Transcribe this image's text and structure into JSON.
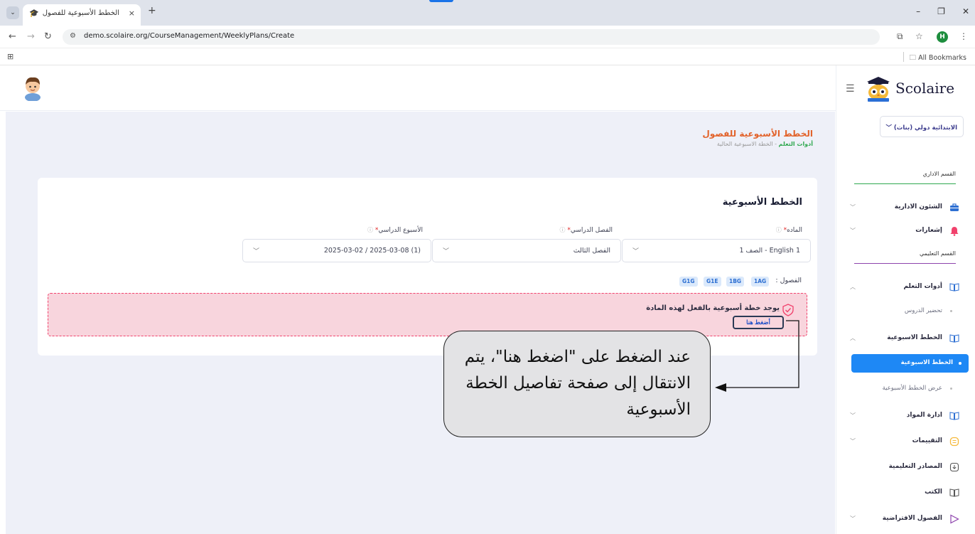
{
  "browser": {
    "tab_title": "الخطط الأسبوعية للفصول",
    "tab_close": "×",
    "new_tab": "+",
    "url": "demo.scolaire.org/CourseManagement/WeeklyPlans/Create",
    "all_bookmarks": "All Bookmarks",
    "profile_initial": "H"
  },
  "header": {
    "page_title": "الخطط الأسبوعية للفصول",
    "breadcrumb_link": "أدوات التعلم",
    "breadcrumb_sep": "-",
    "breadcrumb_current": "الخطة الاسبوعية الحالية"
  },
  "card": {
    "title": "الخطط الأسبوعية",
    "subject_label": "الماده",
    "term_label": "الفصل الدراسي",
    "week_label": "الأسبوع الدراسي",
    "required_mark": "*",
    "info_mark": "ⓘ",
    "subject_value": "1 English - الصف 1",
    "term_value": "الفصل الثالث",
    "week_value": "(1) 2025-03-08 / 2025-03-02",
    "classes_label": "الفصول :",
    "classes": [
      "1AG",
      "1BG",
      "G1E",
      "G1G"
    ]
  },
  "alert": {
    "text": "يوجد خطة أسبوعية بالفعل لهذه المادة",
    "link": "أضغط هنا"
  },
  "callout": {
    "text": "عند الضغط على \"اضغط هنا\"، يتم الانتقال إلى صفحة تفاصيل الخطة الأسبوعية"
  },
  "sidebar": {
    "logo_text": "Scolaire",
    "school": "الابتدائية دولي (بنات)",
    "section_admin": "القسم الاداري",
    "section_edu": "القسم التعليمي",
    "items": {
      "admin_affairs": "الشئون الادارية",
      "notifications": "إشعارات",
      "learning_tools": "أدوات التعلم",
      "lesson_prep": "تحضير الدروس",
      "weekly_plans": "الخطط الاسبوعية",
      "weekly_plans_active": "الخطط الاسبوعية",
      "view_weekly_plans": "عرض الخطط الأسبوعية",
      "subjects_mgmt": "ادارة المواد",
      "assessments": "التقييمات",
      "resources": "المصادر التعليمية",
      "books": "الكتب",
      "virtual_classes": "الفصول الافتراضية"
    }
  },
  "colors": {
    "accent": "#1e88f5",
    "title": "#e2632b",
    "breadcrumb_link": "#2fa84f",
    "alert_bg": "#f8d5dd",
    "alert_border": "#f1416c",
    "admin_rule": "#2fa84f",
    "edu_rule": "#8e44ad"
  }
}
